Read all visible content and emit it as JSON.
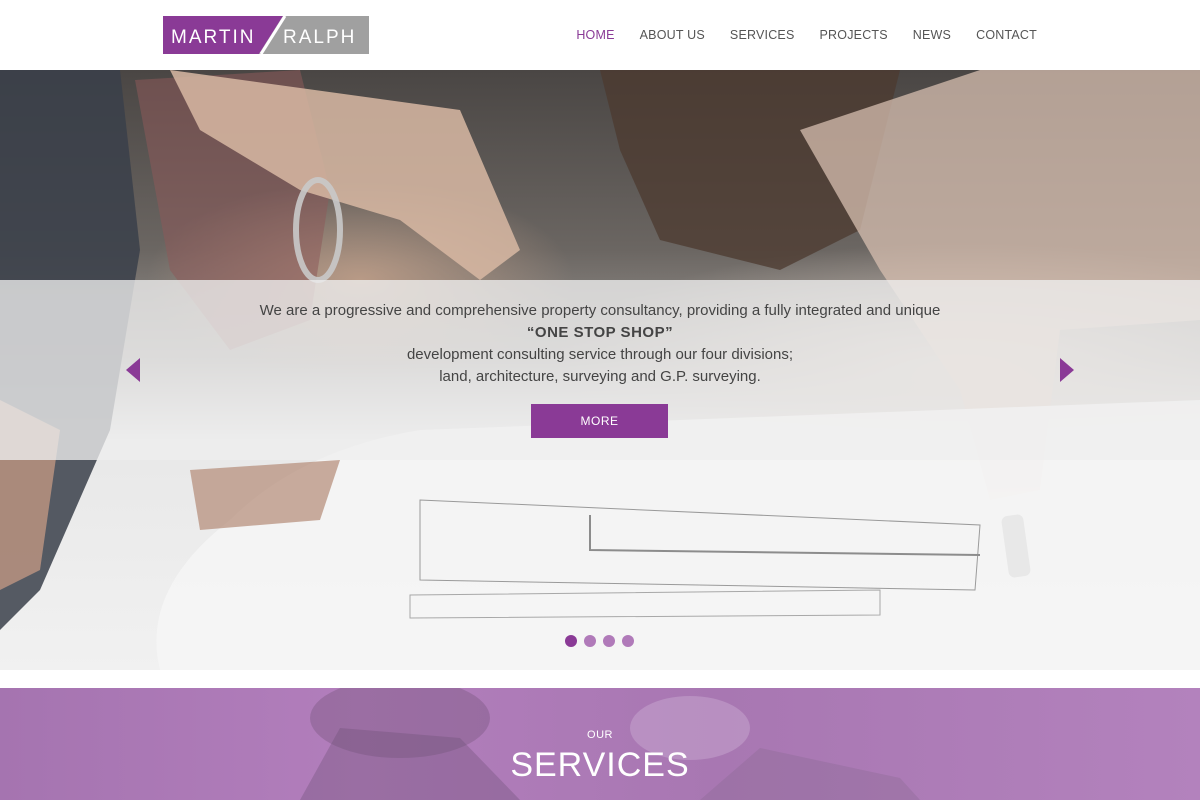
{
  "brand": {
    "logo_left": "MARTIN",
    "logo_right": "RALPH",
    "primary_color": "#8a3a96",
    "secondary_color": "#9b9b9b"
  },
  "nav": {
    "items": [
      {
        "label": "HOME",
        "active": true
      },
      {
        "label": "ABOUT US",
        "active": false
      },
      {
        "label": "SERVICES",
        "active": false
      },
      {
        "label": "PROJECTS",
        "active": false
      },
      {
        "label": "NEWS",
        "active": false
      },
      {
        "label": "CONTACT",
        "active": false
      }
    ]
  },
  "hero": {
    "line1": "We are a progressive and comprehensive property consultancy, providing a fully integrated and unique",
    "line2": "“ONE STOP SHOP”",
    "line3": "development consulting service through our four divisions;",
    "line4": "land, architecture, surveying and G.P. surveying.",
    "button_label": "MORE",
    "prev_icon": "chevron-left-icon",
    "next_icon": "chevron-right-icon",
    "slide_count": 4,
    "active_slide": 1
  },
  "services": {
    "eyebrow": "OUR",
    "title": "SERVICES"
  }
}
